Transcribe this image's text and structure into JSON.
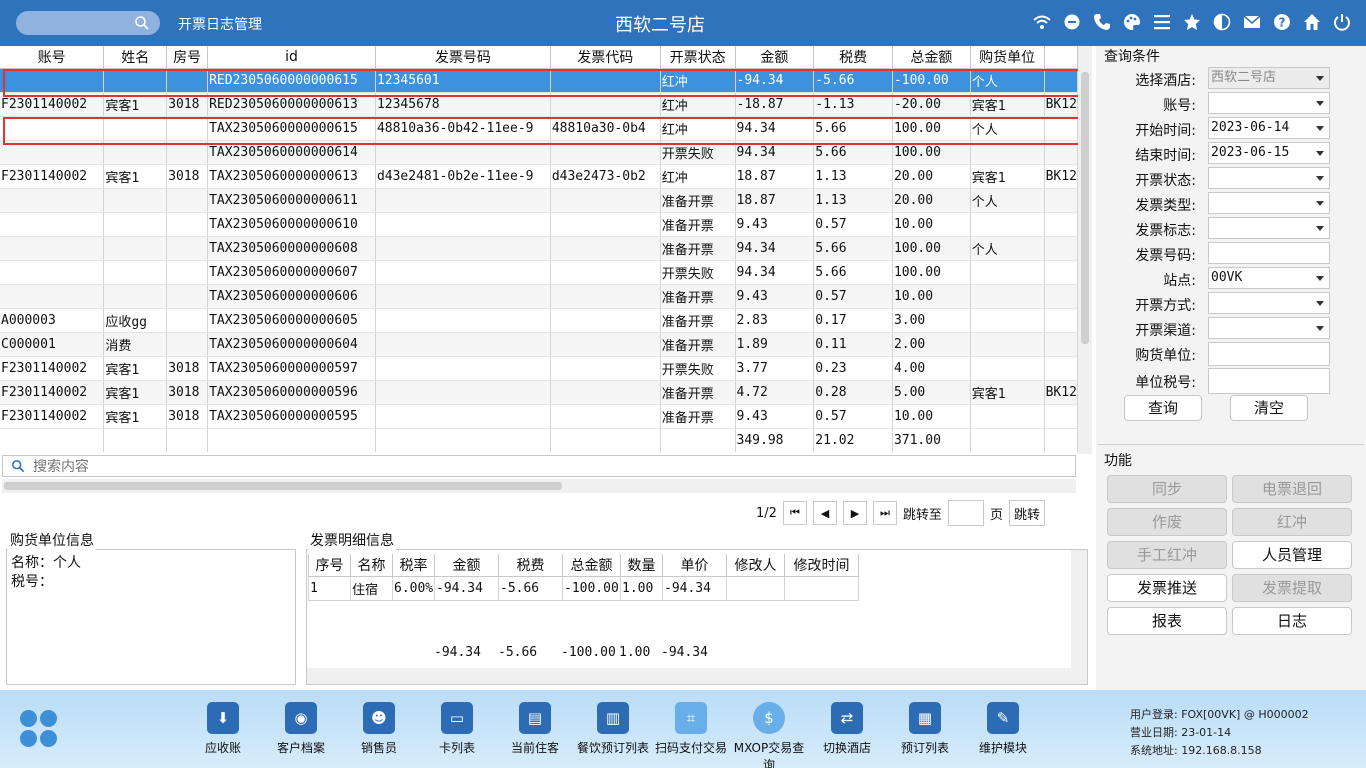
{
  "header": {
    "search_placeholder": "",
    "module_title": "开票日志管理",
    "store_title": "西软二号店",
    "icons": [
      "wifi-icon",
      "chat-icon",
      "phone-icon",
      "palette-icon",
      "menu-icon",
      "star-icon",
      "contrast-icon",
      "mail-icon",
      "help-icon",
      "home-icon",
      "power-icon"
    ]
  },
  "table": {
    "columns": [
      "账号",
      "姓名",
      "房号",
      "id",
      "发票号码",
      "发票代码",
      "开票状态",
      "金额",
      "税费",
      "总金额",
      "购货单位",
      ""
    ],
    "rows": [
      [
        "",
        "",
        "",
        "RED2305060000000615",
        "12345601",
        "",
        "红冲",
        "-94.34",
        "-5.66",
        "-100.00",
        "个人",
        ""
      ],
      [
        "F2301140002",
        "宾客1",
        "3018",
        "RED2305060000000613",
        "12345678",
        "",
        "红冲",
        "-18.87",
        "-1.13",
        "-20.00",
        "宾客1",
        "BK12"
      ],
      [
        "",
        "",
        "",
        "TAX2305060000000615",
        "48810a36-0b42-11ee-9",
        "48810a30-0b4",
        "红冲",
        "94.34",
        "5.66",
        "100.00",
        "个人",
        ""
      ],
      [
        "",
        "",
        "",
        "TAX2305060000000614",
        "",
        "",
        "开票失败",
        "94.34",
        "5.66",
        "100.00",
        "",
        ""
      ],
      [
        "F2301140002",
        "宾客1",
        "3018",
        "TAX2305060000000613",
        "d43e2481-0b2e-11ee-9",
        "d43e2473-0b2",
        "红冲",
        "18.87",
        "1.13",
        "20.00",
        "宾客1",
        "BK12"
      ],
      [
        "",
        "",
        "",
        "TAX2305060000000611",
        "",
        "",
        "准备开票",
        "18.87",
        "1.13",
        "20.00",
        "个人",
        ""
      ],
      [
        "",
        "",
        "",
        "TAX2305060000000610",
        "",
        "",
        "准备开票",
        "9.43",
        "0.57",
        "10.00",
        "",
        ""
      ],
      [
        "",
        "",
        "",
        "TAX2305060000000608",
        "",
        "",
        "准备开票",
        "94.34",
        "5.66",
        "100.00",
        "个人",
        ""
      ],
      [
        "",
        "",
        "",
        "TAX2305060000000607",
        "",
        "",
        "开票失败",
        "94.34",
        "5.66",
        "100.00",
        "",
        ""
      ],
      [
        "",
        "",
        "",
        "TAX2305060000000606",
        "",
        "",
        "准备开票",
        "9.43",
        "0.57",
        "10.00",
        "",
        ""
      ],
      [
        "A000003",
        "应收gg",
        "",
        "TAX2305060000000605",
        "",
        "",
        "准备开票",
        "2.83",
        "0.17",
        "3.00",
        "",
        ""
      ],
      [
        "C000001",
        "消费",
        "",
        "TAX2305060000000604",
        "",
        "",
        "准备开票",
        "1.89",
        "0.11",
        "2.00",
        "",
        ""
      ],
      [
        "F2301140002",
        "宾客1",
        "3018",
        "TAX2305060000000597",
        "",
        "",
        "开票失败",
        "3.77",
        "0.23",
        "4.00",
        "",
        ""
      ],
      [
        "F2301140002",
        "宾客1",
        "3018",
        "TAX2305060000000596",
        "",
        "",
        "准备开票",
        "4.72",
        "0.28",
        "5.00",
        "宾客1",
        "BK12"
      ],
      [
        "F2301140002",
        "宾客1",
        "3018",
        "TAX2305060000000595",
        "",
        "",
        "准备开票",
        "9.43",
        "0.57",
        "10.00",
        "",
        ""
      ]
    ],
    "totals": {
      "amount": "349.98",
      "tax": "21.02",
      "total": "371.00"
    }
  },
  "filter": {
    "placeholder": "搜索内容"
  },
  "pager": {
    "page_info": "1/2",
    "first": "⏮",
    "prev": "◀",
    "next": "▶",
    "last": "⏭",
    "jump_label": "跳转至",
    "page_unit": "页",
    "jump_button": "跳转"
  },
  "buyer": {
    "title": "购货单位信息",
    "name_line": "名称：个人",
    "tax_line": "税号："
  },
  "detail": {
    "title": "发票明细信息",
    "columns": [
      "序号",
      "名称",
      "税率",
      "金额",
      "税费",
      "总金额",
      "数量",
      "单价",
      "修改人",
      "修改时间"
    ],
    "rows": [
      [
        "1",
        "住宿",
        "6.00%",
        "-94.34",
        "-5.66",
        "-100.00",
        "1.00",
        "-94.34",
        "",
        ""
      ]
    ],
    "totals": {
      "amount": "-94.34",
      "tax": "-5.66",
      "total": "-100.00",
      "qty": "1.00",
      "price": "-94.34"
    }
  },
  "query": {
    "title": "查询条件",
    "hotel_label": "选择酒店:",
    "hotel_value": "西软二号店",
    "account_label": "账号:",
    "account_value": "",
    "start_label": "开始时间:",
    "start_value": "2023-06-14",
    "end_label": "结束时间:",
    "end_value": "2023-06-15",
    "status_label": "开票状态:",
    "status_value": "",
    "type_label": "发票类型:",
    "type_value": "",
    "flag_label": "发票标志:",
    "flag_value": "",
    "number_label": "发票号码:",
    "number_value": "",
    "station_label": "站点:",
    "station_value": "00VK",
    "method_label": "开票方式:",
    "method_value": "",
    "channel_label": "开票渠道:",
    "channel_value": "",
    "buyer_label": "购货单位:",
    "buyer_value": "",
    "taxno_label": "单位税号:",
    "taxno_value": "",
    "search_button": "查询",
    "clear_button": "清空"
  },
  "functions": {
    "title": "功能",
    "buttons": [
      "同步",
      "电票退回",
      "作废",
      "红冲",
      "手工红冲",
      "人员管理",
      "发票推送",
      "发票提取",
      "报表",
      "日志"
    ]
  },
  "footer": {
    "items": [
      "应收账",
      "客户档案",
      "销售员",
      "卡列表",
      "当前住客",
      "餐饮预订列表",
      "扫码支付交易",
      "MXOP交易查询",
      "切换酒店",
      "预订列表",
      "维护模块"
    ],
    "user_line": "用户登录:   FOX[00VK] @ H000002",
    "date_line": "营业日期:   23-01-14",
    "addr_line": "系统地址:   192.168.8.158"
  }
}
